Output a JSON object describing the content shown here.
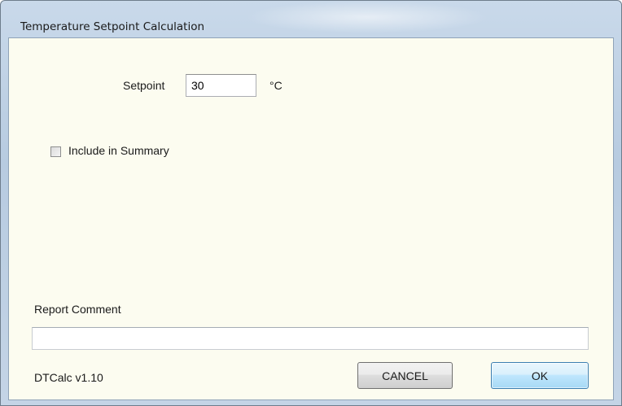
{
  "window": {
    "title": "Temperature Setpoint Calculation"
  },
  "form": {
    "setpoint_label": "Setpoint",
    "setpoint_value": "30",
    "setpoint_unit": "°C",
    "include_summary_label": "Include in Summary",
    "include_summary_checked": false,
    "report_comment_label": "Report Comment",
    "report_comment_value": ""
  },
  "footer": {
    "version": "DTCalc v1.10",
    "cancel_label": "CANCEL",
    "ok_label": "OK"
  },
  "colors": {
    "client_background": "#fcfcf0",
    "ok_button_accent": "#3c7fb1"
  }
}
